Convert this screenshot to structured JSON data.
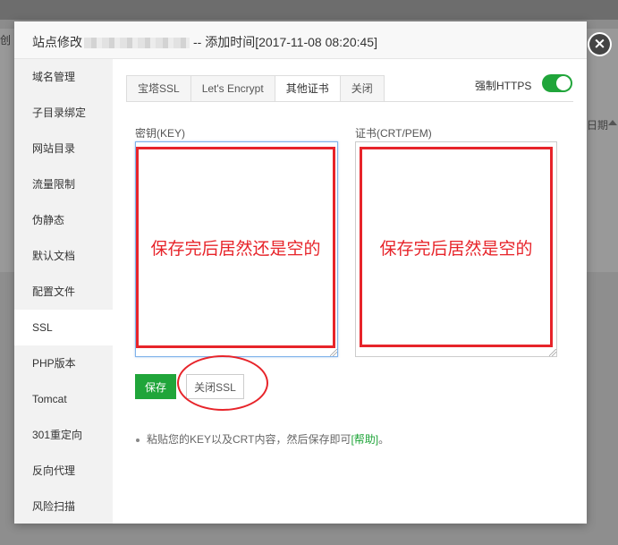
{
  "background": {
    "left_text": "创",
    "right_text": "日期"
  },
  "modal": {
    "title_prefix": "站点修改",
    "title_suffix": "-- 添加时间[2017-11-08 08:20:45]",
    "close_glyph": "×"
  },
  "sidebar": {
    "items": [
      {
        "label": "域名管理"
      },
      {
        "label": "子目录绑定"
      },
      {
        "label": "网站目录"
      },
      {
        "label": "流量限制"
      },
      {
        "label": "伪静态"
      },
      {
        "label": "默认文档"
      },
      {
        "label": "配置文件"
      },
      {
        "label": "SSL"
      },
      {
        "label": "PHP版本"
      },
      {
        "label": "Tomcat"
      },
      {
        "label": "301重定向"
      },
      {
        "label": "反向代理"
      },
      {
        "label": "风险扫描"
      }
    ],
    "active_index": 7
  },
  "tabs": [
    {
      "label": "宝塔SSL"
    },
    {
      "label": "Let's Encrypt"
    },
    {
      "label": "其他证书"
    },
    {
      "label": "关闭"
    }
  ],
  "force_https": {
    "label": "强制HTTPS",
    "enabled": true
  },
  "fields": {
    "key_label": "密钥(KEY)",
    "key_value": "",
    "crt_label": "证书(CRT/PEM)",
    "crt_value": ""
  },
  "annotations": {
    "key_note": "保存完后居然还是空的",
    "crt_note": "保存完后居然是空的"
  },
  "buttons": {
    "save": "保存",
    "close_ssl": "关闭SSL"
  },
  "tip": {
    "text": "粘贴您的KEY以及CRT内容，然后保存即可",
    "link": "[帮助]",
    "end": "。"
  },
  "colors": {
    "accent_green": "#20a53a",
    "annotation_red": "#e7242a"
  }
}
